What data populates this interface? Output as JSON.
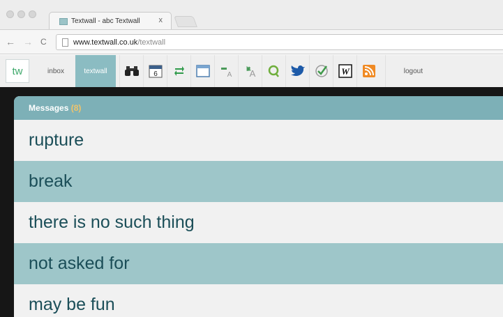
{
  "browser": {
    "tab_title": "Textwall - abc Textwall",
    "tab_close": "x",
    "nav": {
      "back": "←",
      "forward": "→",
      "reload": "C"
    },
    "url_host": "www.textwall.co.uk",
    "url_path": "/textwall"
  },
  "app": {
    "logo_text": "tw",
    "nav_inbox": "inbox",
    "nav_textwall": "textwall",
    "nav_logout": "logout",
    "calendar_day": "6",
    "wikipedia_letter": "W",
    "colors": {
      "teal_accent": "#8bbcc2",
      "row_alt": "#9ec6c9",
      "message_text": "#1b4e58",
      "rss_orange": "#f08a24",
      "twitter_blue": "#1d5aa8"
    },
    "toolbar_icons": [
      "binoculars-icon",
      "calendar-icon",
      "exchange-icon",
      "table-icon",
      "font-decrease-icon",
      "font-increase-icon",
      "search-q-icon",
      "twitter-bird-icon",
      "check-circle-icon",
      "wikipedia-icon",
      "rss-icon"
    ]
  },
  "messages": {
    "title": "Messages",
    "count_open": "(",
    "count": "8",
    "count_close": ")",
    "items": [
      "rupture",
      "break",
      "there is no such thing",
      "not asked for",
      "may be fun"
    ]
  }
}
